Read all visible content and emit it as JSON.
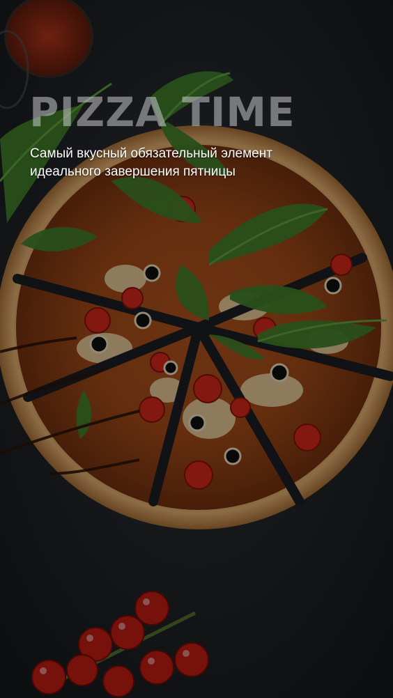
{
  "story": {
    "title": "PIZZA TIME",
    "subtitle": "Самый вкусный обязательный элемент идеального завершения пятницы"
  },
  "photo": {
    "subject": "pizza-photo",
    "colors": {
      "background": "#1e2125",
      "crust": "#c9955a",
      "sauce": "#8a2a10",
      "arugula": "#3f7a2a",
      "tomato": "#c22a16",
      "olive": "#111111",
      "cheese": "#e8d8b0"
    }
  }
}
